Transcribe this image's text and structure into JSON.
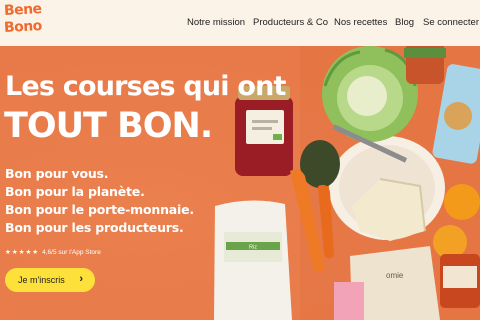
{
  "brand": {
    "logo_line1": "Bene",
    "logo_line2": "Bono"
  },
  "nav": {
    "items": [
      {
        "label": "Notre mission"
      },
      {
        "label": "Producteurs & Co"
      },
      {
        "label": "Nos recettes"
      },
      {
        "label": "Blog"
      },
      {
        "label": "Se connecter"
      }
    ]
  },
  "hero": {
    "headline_line1": "Les courses qui ont",
    "headline_line2": "TOUT BON.",
    "benefits": [
      "Bon pour vous.",
      "Bon pour la planète.",
      "Bon pour le porte-monnaie.",
      "Bon pour les producteurs."
    ],
    "rating_stars": "★★★★★",
    "rating_text": "4,6/5 sur l'App Store",
    "cta_label": "Je m'inscris",
    "cta_arrow": "›",
    "product_labels": {
      "rice_bag": "Riz",
      "snack_pack": "omie"
    }
  },
  "colors": {
    "accent": "#ef6a2e",
    "hero_bg": "#e77a48",
    "cta": "#fde13a",
    "header_bg": "#fbf3e8"
  },
  "icons": [
    "star-icon",
    "chevron-right-icon"
  ]
}
